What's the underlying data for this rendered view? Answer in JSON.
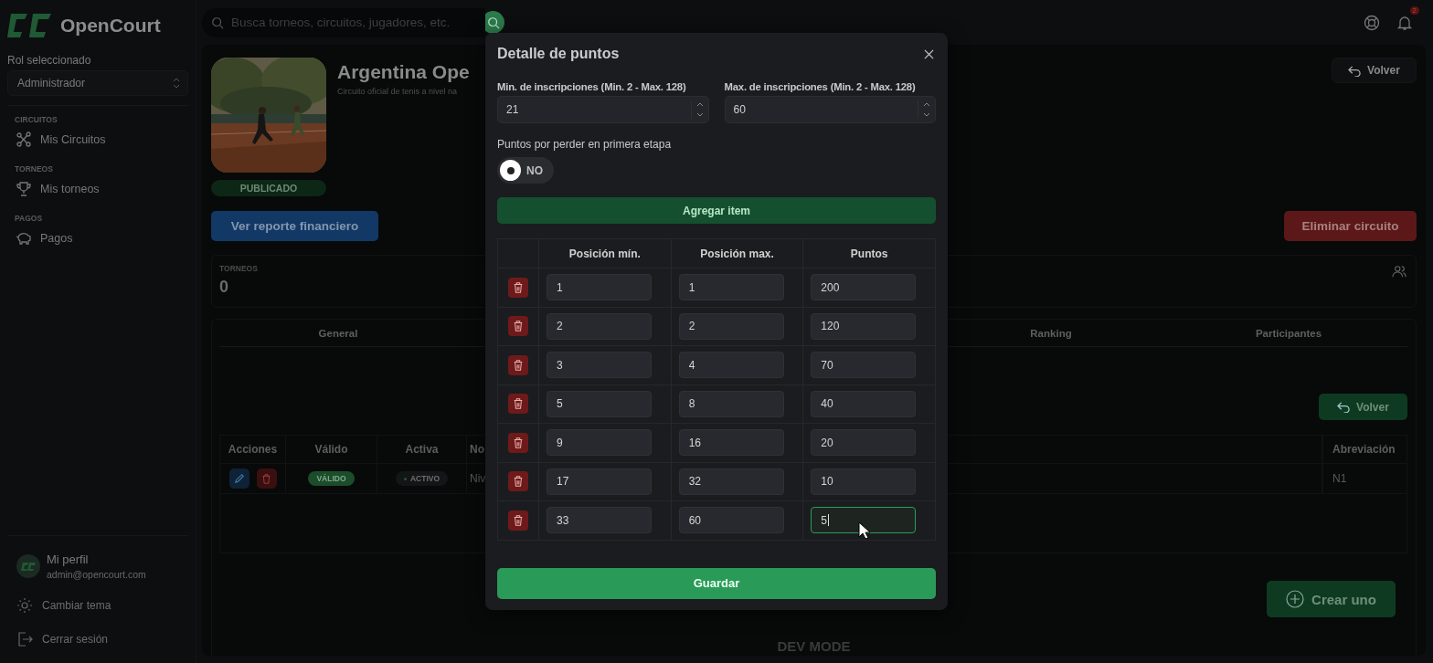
{
  "brand": {
    "name": "OpenCourt"
  },
  "search": {
    "placeholder": "Busca torneos, circuitos, jugadores, etc."
  },
  "notifications": {
    "count": "2"
  },
  "sidebar": {
    "role_label": "Rol seleccionado",
    "role_value": "Administrador",
    "sections": [
      {
        "heading": "CIRCUITOS",
        "items": [
          {
            "label": "Mis Circuitos"
          }
        ]
      },
      {
        "heading": "TORNEOS",
        "items": [
          {
            "label": "Mis torneos"
          }
        ]
      },
      {
        "heading": "PAGOS",
        "items": [
          {
            "label": "Pagos"
          }
        ]
      }
    ],
    "profile": {
      "name": "Mi perfil",
      "email": "admin@opencourt.com"
    },
    "footer_items": [
      {
        "label": "Cambiar tema"
      },
      {
        "label": "Cerrar sesión"
      }
    ]
  },
  "circuit": {
    "title": "Argentina Ope",
    "subtitle": "Circuito oficial de tenis a nivel na",
    "status": "PUBLICADO",
    "back": "Volver",
    "report": "Ver reporte financiero",
    "delete": "Eliminar circuito"
  },
  "stats": {
    "label": "TORNEOS",
    "value": "0"
  },
  "tabs": [
    {
      "label": "General"
    },
    {
      "label": "Ranking"
    },
    {
      "label": "Participantes"
    }
  ],
  "levels": {
    "back": "Volver",
    "columns": [
      "Acciones",
      "Válido",
      "Activa",
      "No",
      "Abreviación"
    ],
    "rows": [
      {
        "valid": "VÁLIDO",
        "active": "ACTIVO",
        "column_4": "Niv",
        "abbreviation": "N1"
      }
    ],
    "create": "Crear uno"
  },
  "dev_mode": "DEV MODE",
  "modal": {
    "title": "Detalle de puntos",
    "min_label": "Min. de inscripciones (Min. 2 - Max. 128)",
    "min_value": "21",
    "max_label": "Max. de inscripciones (Min. 2 - Max. 128)",
    "max_value": "60",
    "toggle_label": "Puntos por perder en primera etapa",
    "toggle": {
      "on": false,
      "label": "NO"
    },
    "add": "Agregar item",
    "columns": [
      "Posición mín.",
      "Posición max.",
      "Puntos"
    ],
    "rows": [
      {
        "min": "1",
        "max": "1",
        "points": "200",
        "focused": false
      },
      {
        "min": "2",
        "max": "2",
        "points": "120",
        "focused": false
      },
      {
        "min": "3",
        "max": "4",
        "points": "70",
        "focused": false
      },
      {
        "min": "5",
        "max": "8",
        "points": "40",
        "focused": false
      },
      {
        "min": "9",
        "max": "16",
        "points": "20",
        "focused": false
      },
      {
        "min": "17",
        "max": "32",
        "points": "10",
        "focused": false
      },
      {
        "min": "33",
        "max": "60",
        "points": "5",
        "focused": true
      }
    ],
    "save": "Guardar"
  }
}
